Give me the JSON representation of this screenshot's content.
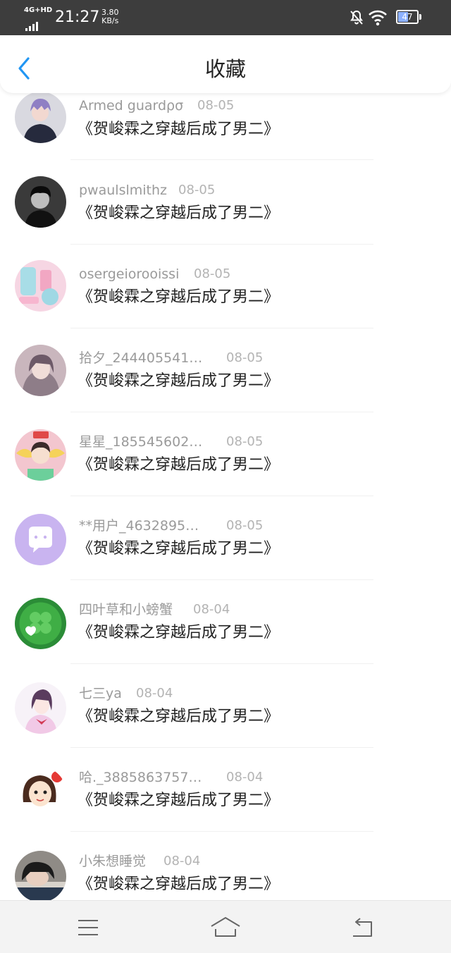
{
  "status_bar": {
    "network": "4G+HD",
    "time": "21:27",
    "speed_value": "3.80",
    "speed_unit": "KB/s",
    "battery": "47",
    "icons": [
      "signal-icon",
      "mute-icon",
      "wifi-icon",
      "battery-icon"
    ]
  },
  "header": {
    "title": "收藏",
    "back_icon": "chevron-left-icon",
    "accent_color": "#2196f3"
  },
  "items": [
    {
      "user": "Armed guardρσ",
      "date": "08-05",
      "book": "《贺峻霖之穿越后成了男二》",
      "avatar": "avatar-purple-hair"
    },
    {
      "user": "pwaulslmithz",
      "date": "08-05",
      "book": "《贺峻霖之穿越后成了男二》",
      "avatar": "avatar-bw-portrait"
    },
    {
      "user": "osergeiorooissi",
      "date": "08-05",
      "book": "《贺峻霖之穿越后成了男二》",
      "avatar": "avatar-pastel-items"
    },
    {
      "user": "拾夕_244405541…",
      "date": "08-05",
      "book": "《贺峻霖之穿越后成了男二》",
      "avatar": "avatar-anime-girl"
    },
    {
      "user": "星星_185545602…",
      "date": "08-05",
      "book": "《贺峻霖之穿越后成了男二》",
      "avatar": "avatar-boy-wings"
    },
    {
      "user": "**用户_4632895…",
      "date": "08-05",
      "book": "《贺峻霖之穿越后成了男二》",
      "avatar": "avatar-default-purple"
    },
    {
      "user": "四叶草和小螃蟹",
      "date": "08-04",
      "book": "《贺峻霖之穿越后成了男二》",
      "avatar": "avatar-green-clover"
    },
    {
      "user": "七三ya",
      "date": "08-04",
      "book": "《贺峻霖之穿越后成了男二》",
      "avatar": "avatar-anime-pink"
    },
    {
      "user": "哈._3885863757…",
      "date": "08-04",
      "book": "《贺峻霖之穿越后成了男二》",
      "avatar": "avatar-cartoon-girl"
    },
    {
      "user": "小朱想睡觉",
      "date": "08-04",
      "book": "《贺峻霖之穿越后成了男二》",
      "avatar": "avatar-sleeping-girl"
    }
  ],
  "bottom_nav": {
    "buttons": [
      "menu-icon",
      "home-icon",
      "back-icon"
    ]
  }
}
